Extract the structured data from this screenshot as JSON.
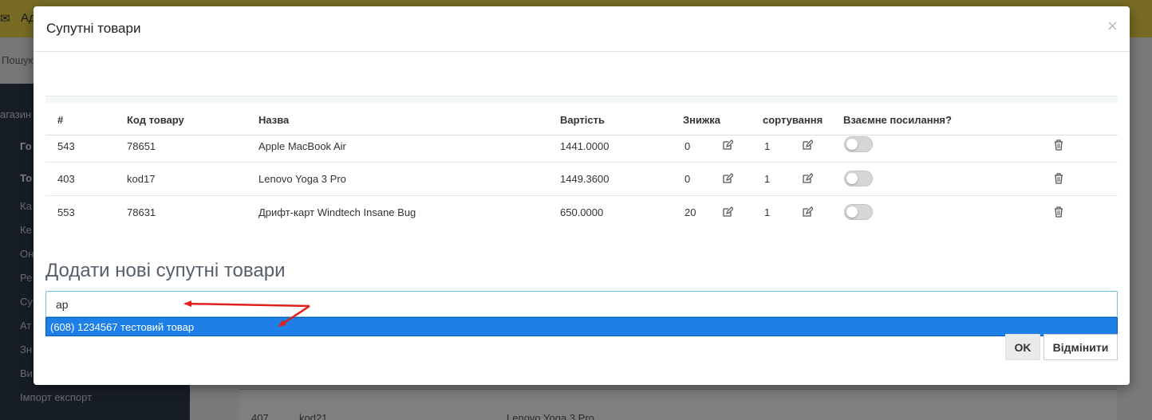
{
  "background": {
    "topbar_title": "Ад",
    "search_label": "Пошук",
    "sidebar_heading": "агазин",
    "sidebar_items": [
      "Го",
      "То",
      "Ка",
      "Ке",
      "Он",
      "Ре",
      "Су",
      "Ат",
      "Зн",
      "Ви",
      "Імпорт експорт"
    ],
    "table_row": {
      "id": "407",
      "code": "kod21",
      "name": "Lenovo Yoga 3 Pro"
    }
  },
  "modal": {
    "title": "Супутні товари",
    "close_label": "×",
    "columns": [
      "#",
      "Код товару",
      "Назва",
      "Вартість",
      "Знижка",
      "сортування",
      "Взаємне посилання?"
    ],
    "rows": [
      {
        "id": "543",
        "code": "78651",
        "name": "Apple MacBook Air",
        "price": "1441.0000",
        "discount": "0",
        "sort": "1",
        "mutual": false
      },
      {
        "id": "403",
        "code": "kod17",
        "name": "Lenovo Yoga 3 Pro",
        "price": "1449.3600",
        "discount": "0",
        "sort": "1",
        "mutual": false
      },
      {
        "id": "553",
        "code": "78631",
        "name": "Дрифт-карт Windtech Insane Bug",
        "price": "650.0000",
        "discount": "20",
        "sort": "1",
        "mutual": false
      }
    ],
    "add_heading": "Додати нові супутні товари",
    "search_value": "ap",
    "suggestion": "(608) 1234567 тестовий товар",
    "ok_label": "OK",
    "cancel_label": "Відмінити"
  },
  "colors": {
    "suggestion_bg": "#1e7fe6",
    "annotation_arrow": "#e0201b",
    "input_focus_border": "#66c4e0"
  }
}
